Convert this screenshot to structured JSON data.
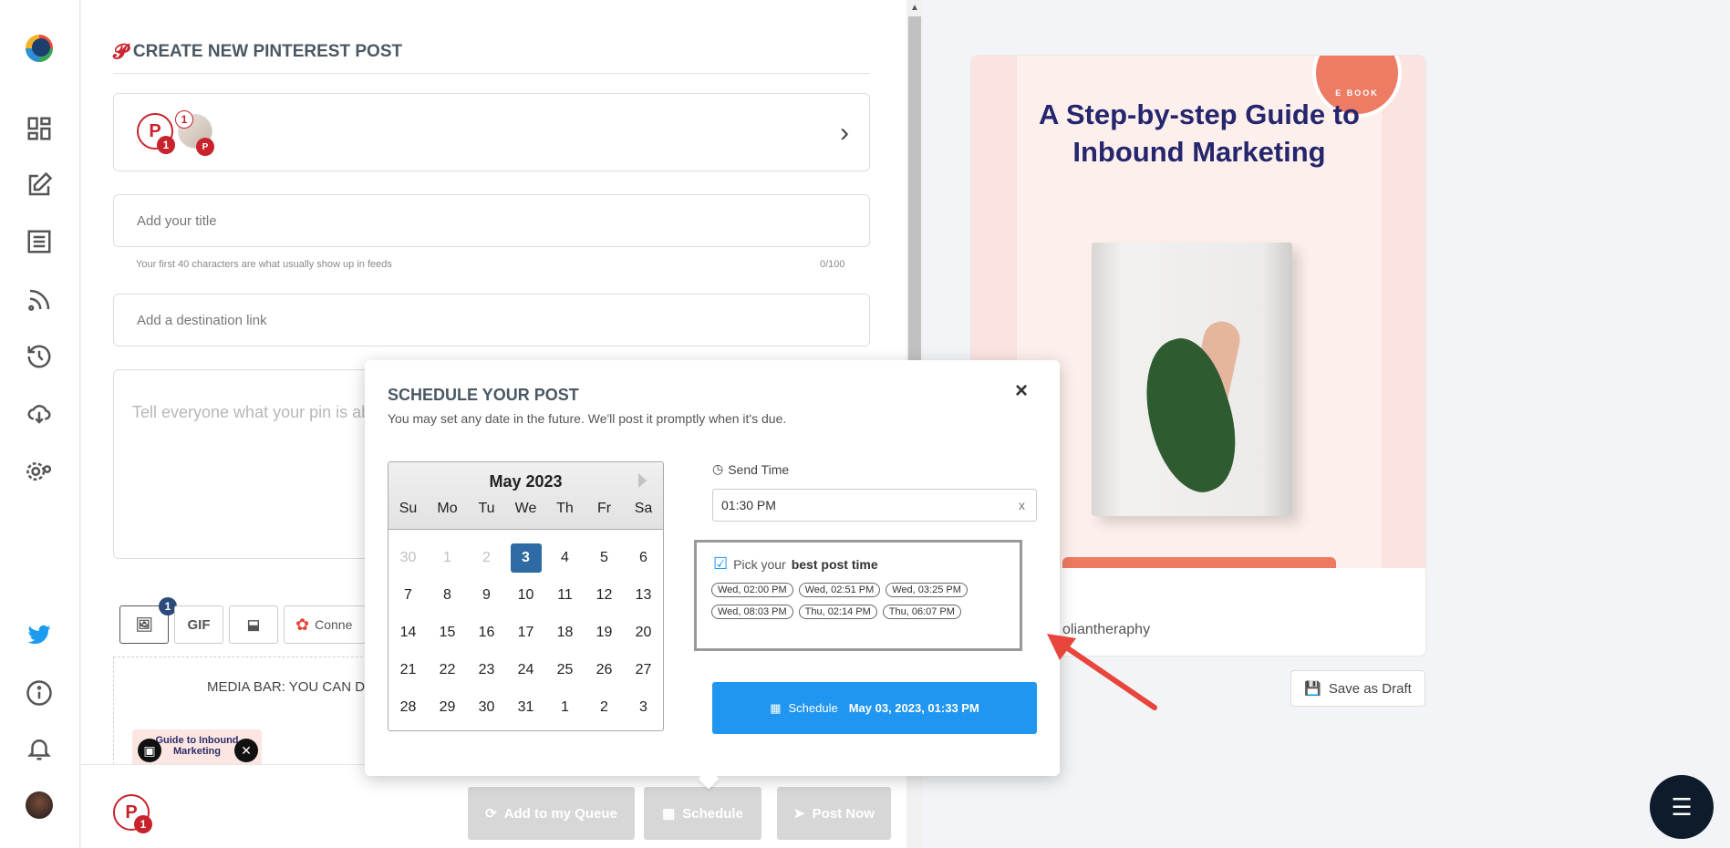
{
  "sidebar": {
    "icons": [
      "logo-icon",
      "dashboard-icon",
      "compose-icon",
      "posts-icon",
      "rss-icon",
      "history-icon",
      "cloud-download-icon",
      "settings-icon",
      "twitter-icon",
      "info-icon",
      "bell-icon",
      "profile-avatar"
    ]
  },
  "composer": {
    "title": "CREATE NEW PINTEREST POST",
    "account_badge": "1",
    "account_count_top": "1",
    "title_placeholder": "Add your title",
    "title_hint": "Your first 40 characters are what usually show up in feeds",
    "title_counter": "0/100",
    "link_placeholder": "Add a destination link",
    "description_placeholder": "Tell everyone what your pin is about",
    "media_badge": "1",
    "gif_label": "GIF",
    "connect_label": "Conne",
    "media_bar_text": "MEDIA BAR: YOU CAN DRA",
    "thumb_caption": "Guide to Inbound Marketing",
    "bottom_badge": "1",
    "buttons": {
      "queue": "Add to my Queue",
      "schedule": "Schedule",
      "post_now": "Post Now"
    }
  },
  "preview": {
    "seal_text": "E BOOK",
    "heading": "A Step-by-step Guide to Inbound Marketing",
    "username": "oliantheraphy",
    "save_draft": "Save as Draft"
  },
  "schedule_modal": {
    "title": "SCHEDULE YOUR POST",
    "subtitle": "You may set any date in the future. We'll post it promptly when it's due.",
    "close": "×",
    "calendar": {
      "month": "May 2023",
      "dows": [
        "Su",
        "Mo",
        "Tu",
        "We",
        "Th",
        "Fr",
        "Sa"
      ],
      "days": [
        "30",
        "1",
        "2",
        "3",
        "4",
        "5",
        "6",
        "7",
        "8",
        "9",
        "10",
        "11",
        "12",
        "13",
        "14",
        "15",
        "16",
        "17",
        "18",
        "19",
        "20",
        "21",
        "22",
        "23",
        "24",
        "25",
        "26",
        "27",
        "28",
        "29",
        "30",
        "31",
        "1",
        "2",
        "3"
      ],
      "muted_indices": [
        0,
        1,
        2
      ],
      "selected_index": 3
    },
    "send_time_label": "Send Time",
    "send_time_value": "01:30 PM",
    "clear": "x",
    "best_time_prefix": "Pick your",
    "best_time_bold": "best post time",
    "best_times": [
      "Wed, 02:00 PM",
      "Wed, 02:51 PM",
      "Wed, 03:25 PM",
      "Wed, 08:03 PM",
      "Thu, 02:14 PM",
      "Thu, 06:07 PM"
    ],
    "schedule_label": "Schedule",
    "schedule_datetime": "May 03, 2023, 01:33 PM"
  },
  "colors": {
    "pinterest_red": "#c8232c",
    "selected_day": "#2e6aa3",
    "schedule_blue": "#2096f0",
    "arrow_red": "#e8453c"
  }
}
